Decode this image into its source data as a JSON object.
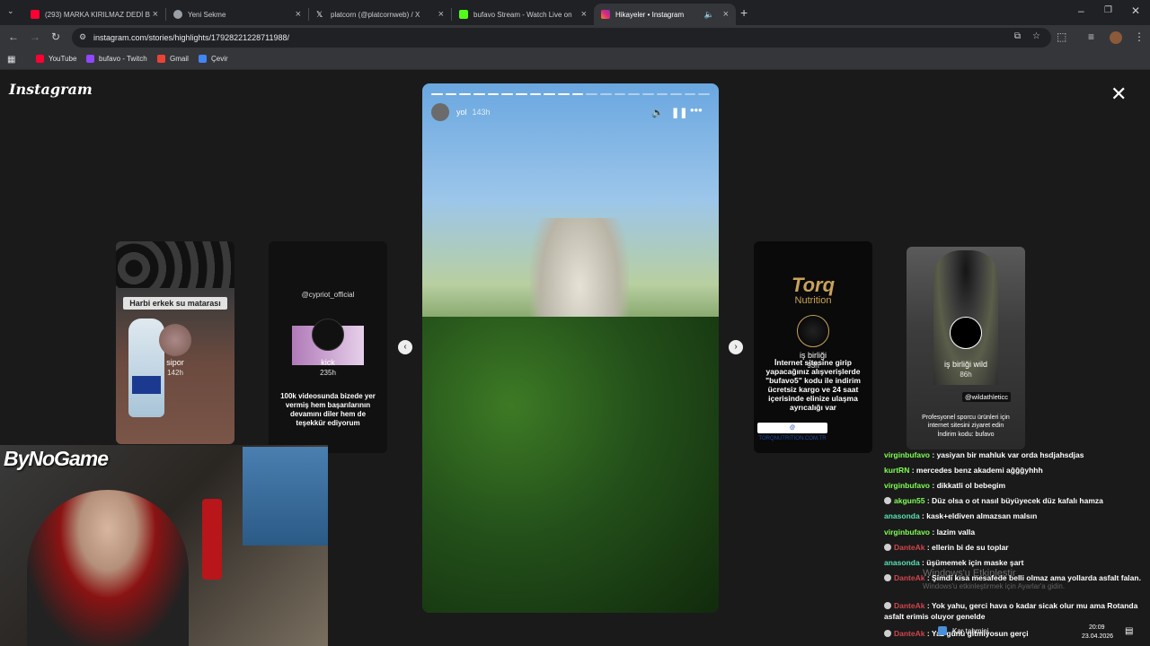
{
  "browser": {
    "tabs": [
      {
        "title": "(293) MARKA KIRILMAZ DEDİ B",
        "icon": "youtube-icon",
        "color": "#ff0033"
      },
      {
        "title": "Yeni Sekme",
        "icon": "chrome-icon",
        "color": "#9aa0a6"
      },
      {
        "title": "platcorn (@platcornweb) / X",
        "icon": "x-icon",
        "color": "#ffffff"
      },
      {
        "title": "bufavo Stream - Watch Live on",
        "icon": "kick-icon",
        "color": "#53fc18"
      },
      {
        "title": "Hikayeler • Instagram",
        "icon": "instagram-icon",
        "color": "#e1306c"
      }
    ],
    "new_tab": "+",
    "url": "instagram.com/stories/highlights/17928221228711988/",
    "bookmarks": [
      {
        "label": "YouTube",
        "color": "#ff0033"
      },
      {
        "label": "bufavo - Twitch",
        "color": "#9146ff"
      },
      {
        "label": "Gmail",
        "color": "#ea4335"
      },
      {
        "label": "Çevir",
        "color": "#4285f4"
      }
    ]
  },
  "instagram": {
    "logo": "Instagram",
    "close": "✕",
    "story": {
      "user": "yol",
      "time": "143h",
      "segments_total": 20,
      "segments_done": 11
    },
    "side_cards": [
      {
        "name": "sipor",
        "time": "142h",
        "caption": "Harbi erkek su matarası"
      },
      {
        "name": "kick",
        "time": "235h",
        "caption_top": "@cypriot_official",
        "caption": "100k videosunda bizede yer vermiş hem başarılarının devamını diler hem de teşekkür ediyorum"
      },
      {
        "name": "iş birliği",
        "time": "93h",
        "brand": "Torq",
        "brand_sub": "Nutrition",
        "caption": "İnternet sitesine girip yapacağınız alışverişlerde \"bufavo5\" kodu ile indirim ücretsiz kargo ve 24 saat içerisinde elinize ulaşma ayrıcalığı var",
        "link": "@ TORQNUTRITION.COM.TR"
      },
      {
        "name": "iş birliği wild",
        "time": "86h",
        "handle": "@wildathleticc",
        "caption": "Profesyonel sporcu ürünleri için internet sitesini ziyaret edin",
        "code": "İndirim kodu: bufavo"
      }
    ]
  },
  "stream": {
    "brand": "ByNoGame",
    "chat": [
      {
        "user": "virginbufavo",
        "text": " : yasiyan bir mahluk var orda hsdjahsdjas",
        "color": "green"
      },
      {
        "user": "kurtRN",
        "text": " : mercedes benz akademi aĝĝĝyhhh",
        "color": "green"
      },
      {
        "user": "virginbufavo",
        "text": " : dikkatli ol bebegim",
        "color": "green"
      },
      {
        "user": "akgun55",
        "text": " : Düz olsa o ot nasıl büyüyecek düz kafalı hamza",
        "color": "green",
        "badge": true
      },
      {
        "user": "anasonda",
        "text": " : kask+eldiven almazsan malsın",
        "color": "teal"
      },
      {
        "user": "virginbufavo",
        "text": " : lazim valla",
        "color": "green"
      },
      {
        "user": "DanteAk",
        "text": " : ellerin bi de su toplar",
        "color": "red",
        "badge": true
      },
      {
        "user": "anasonda",
        "text": " : üşümemek için maske şart",
        "color": "teal"
      },
      {
        "user": "DanteAk",
        "text": " : Şimdi kısa mesafede belli olmaz ama yollarda asfalt falan.",
        "color": "red",
        "badge": true
      },
      {
        "user": "DanteAk",
        "text": " : Yok yahu, gerci hava o kadar sicak olur mu ama Rotanda asfalt erimis oluyor genelde",
        "color": "red",
        "badge": true
      },
      {
        "user": "DanteAk",
        "text": " : Yaz günü gitmiyosun gerçi",
        "color": "red",
        "badge": true
      }
    ],
    "watermark": "Windows'u Etkinleştir",
    "watermark_sub": "Windows'u etkinleştirmek için Ayarlar'a gidin.",
    "taskbar_weather": "Kar tahmini",
    "taskbar_time": "20:09",
    "taskbar_date": "23.04.2026"
  }
}
